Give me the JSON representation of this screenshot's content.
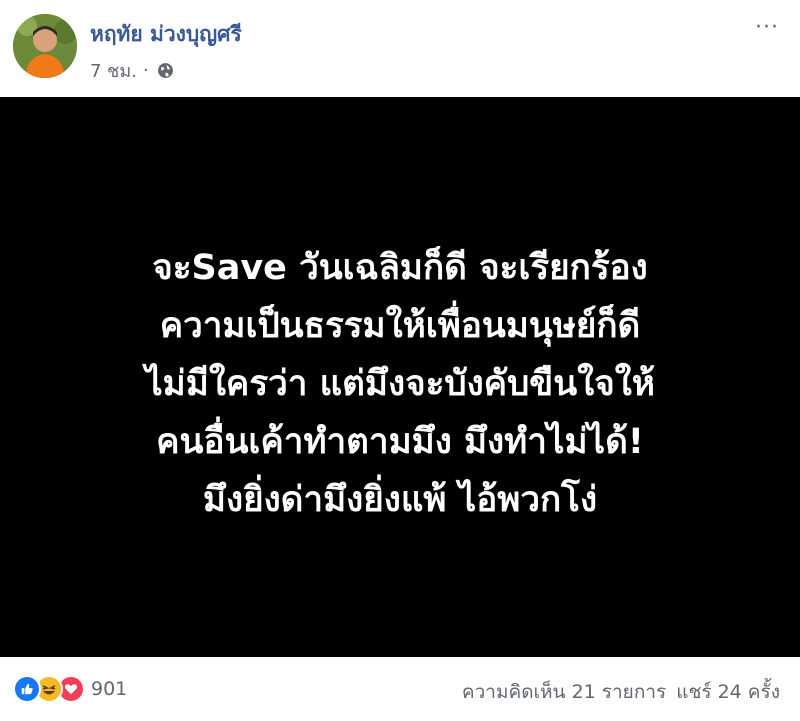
{
  "post": {
    "author_name": "หฤทัย ม่วงบุญศรี",
    "timestamp": "7 ชม.",
    "separator": "·",
    "privacy_icon": "globe-icon",
    "more_icon": "more-options-icon",
    "more_label": "···",
    "image_text_lines": [
      "จะSave วันเฉลิมก็ดี จะเรียกร้อง",
      "ความเป็นธรรมให้เพื่อนมนุษย์ก็ดี",
      "ไม่มีใครว่า แต่มึงจะบังคับขืนใจให้",
      "คนอื่นเค้าทำตามมึง มึงทำไม่ได้!",
      "มึงยิ่งด่ามึงยิ่งแพ้ ไอ้พวกโง่"
    ],
    "image_background": "#000000",
    "image_text_color": "#ffffff"
  },
  "footer": {
    "reaction_icons": [
      "like-icon",
      "haha-icon",
      "love-icon"
    ],
    "reaction_count": "901",
    "comments": "ความคิดเห็น 21 รายการ",
    "shares": "แชร์ 24 ครั้ง"
  },
  "colors": {
    "author_link": "#385898",
    "meta_text": "#606770",
    "like_blue": "#1877f2",
    "haha_yellow": "#f7b928",
    "love_red": "#f33e58"
  }
}
